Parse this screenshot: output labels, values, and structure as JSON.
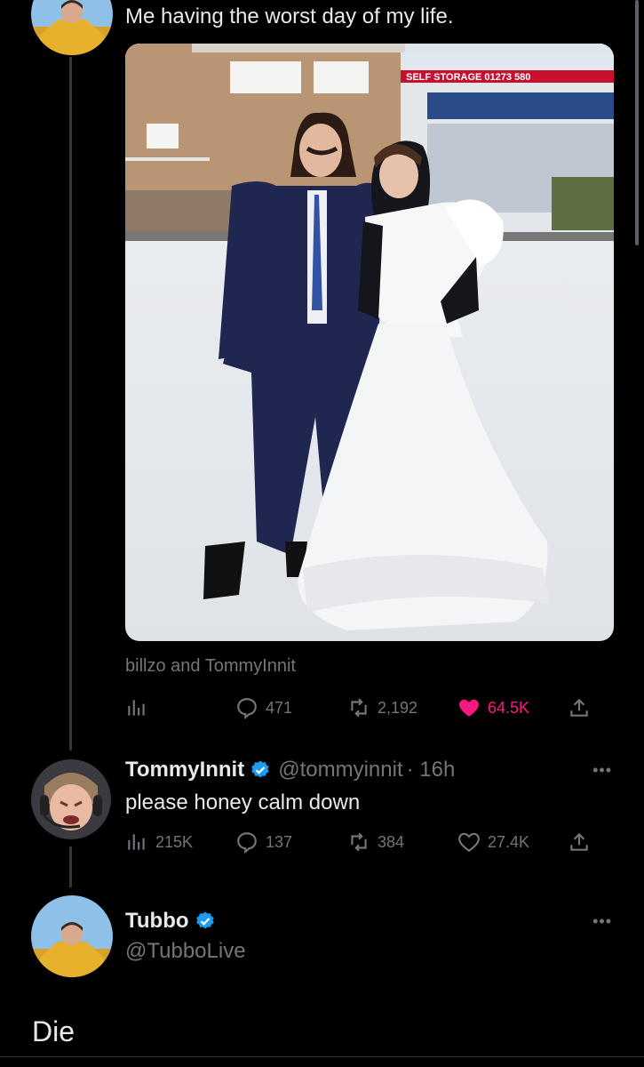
{
  "colors": {
    "background": "#000000",
    "text": "#e7e9ea",
    "muted": "#71767b",
    "like": "#f91880",
    "verified": "#1d9bf0"
  },
  "tweet1": {
    "text": "Me having the worst day of my life.",
    "tagged": "billzo and TommyInnit",
    "stats": {
      "views_icon": "bar-chart-icon",
      "replies": "471",
      "retweets": "2,192",
      "likes": "64.5K",
      "liked": true
    }
  },
  "tweet2": {
    "name": "TommyInnit",
    "handle": "@tommyinnit",
    "time": "· 16h",
    "text": "please honey calm down",
    "stats": {
      "views": "215K",
      "replies": "137",
      "retweets": "384",
      "likes": "27.4K"
    }
  },
  "tweet3": {
    "name": "Tubbo",
    "handle": "@TubboLive",
    "text": "Die"
  },
  "more_label": "•••"
}
